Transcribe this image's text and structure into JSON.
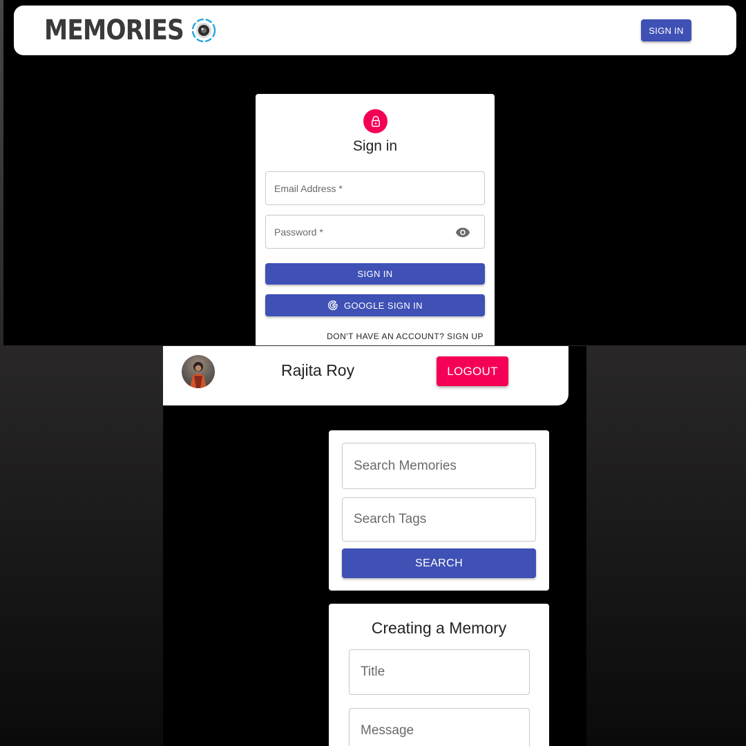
{
  "login_screen": {
    "brand": {
      "name": "Memories",
      "logo_icon": "camera-lens-icon"
    },
    "appbar": {
      "signin_label": "SIGN IN"
    },
    "card": {
      "icon": "lock-icon",
      "title": "Sign in",
      "email_label": "Email Address *",
      "password_label": "Password *",
      "password_toggle_icon": "eye-icon",
      "signin_label": "SIGN IN",
      "google_label": "GOOGLE SIGN IN",
      "google_icon": "google-icon",
      "signup_link": "DON'T HAVE AN ACCOUNT? SIGN UP"
    }
  },
  "home_screen": {
    "user": {
      "name": "Rajita Roy",
      "avatar": "user-avatar-photo"
    },
    "logout_label": "LOGOUT",
    "search": {
      "memories_placeholder": "Search Memories",
      "tags_placeholder": "Search Tags",
      "button_label": "SEARCH"
    },
    "create": {
      "heading": "Creating a Memory",
      "title_placeholder": "Title",
      "message_placeholder": "Message"
    }
  },
  "colors": {
    "primary": "#3f51b5",
    "secondary": "#f50057",
    "background": "#000000",
    "surface": "#ffffff"
  }
}
